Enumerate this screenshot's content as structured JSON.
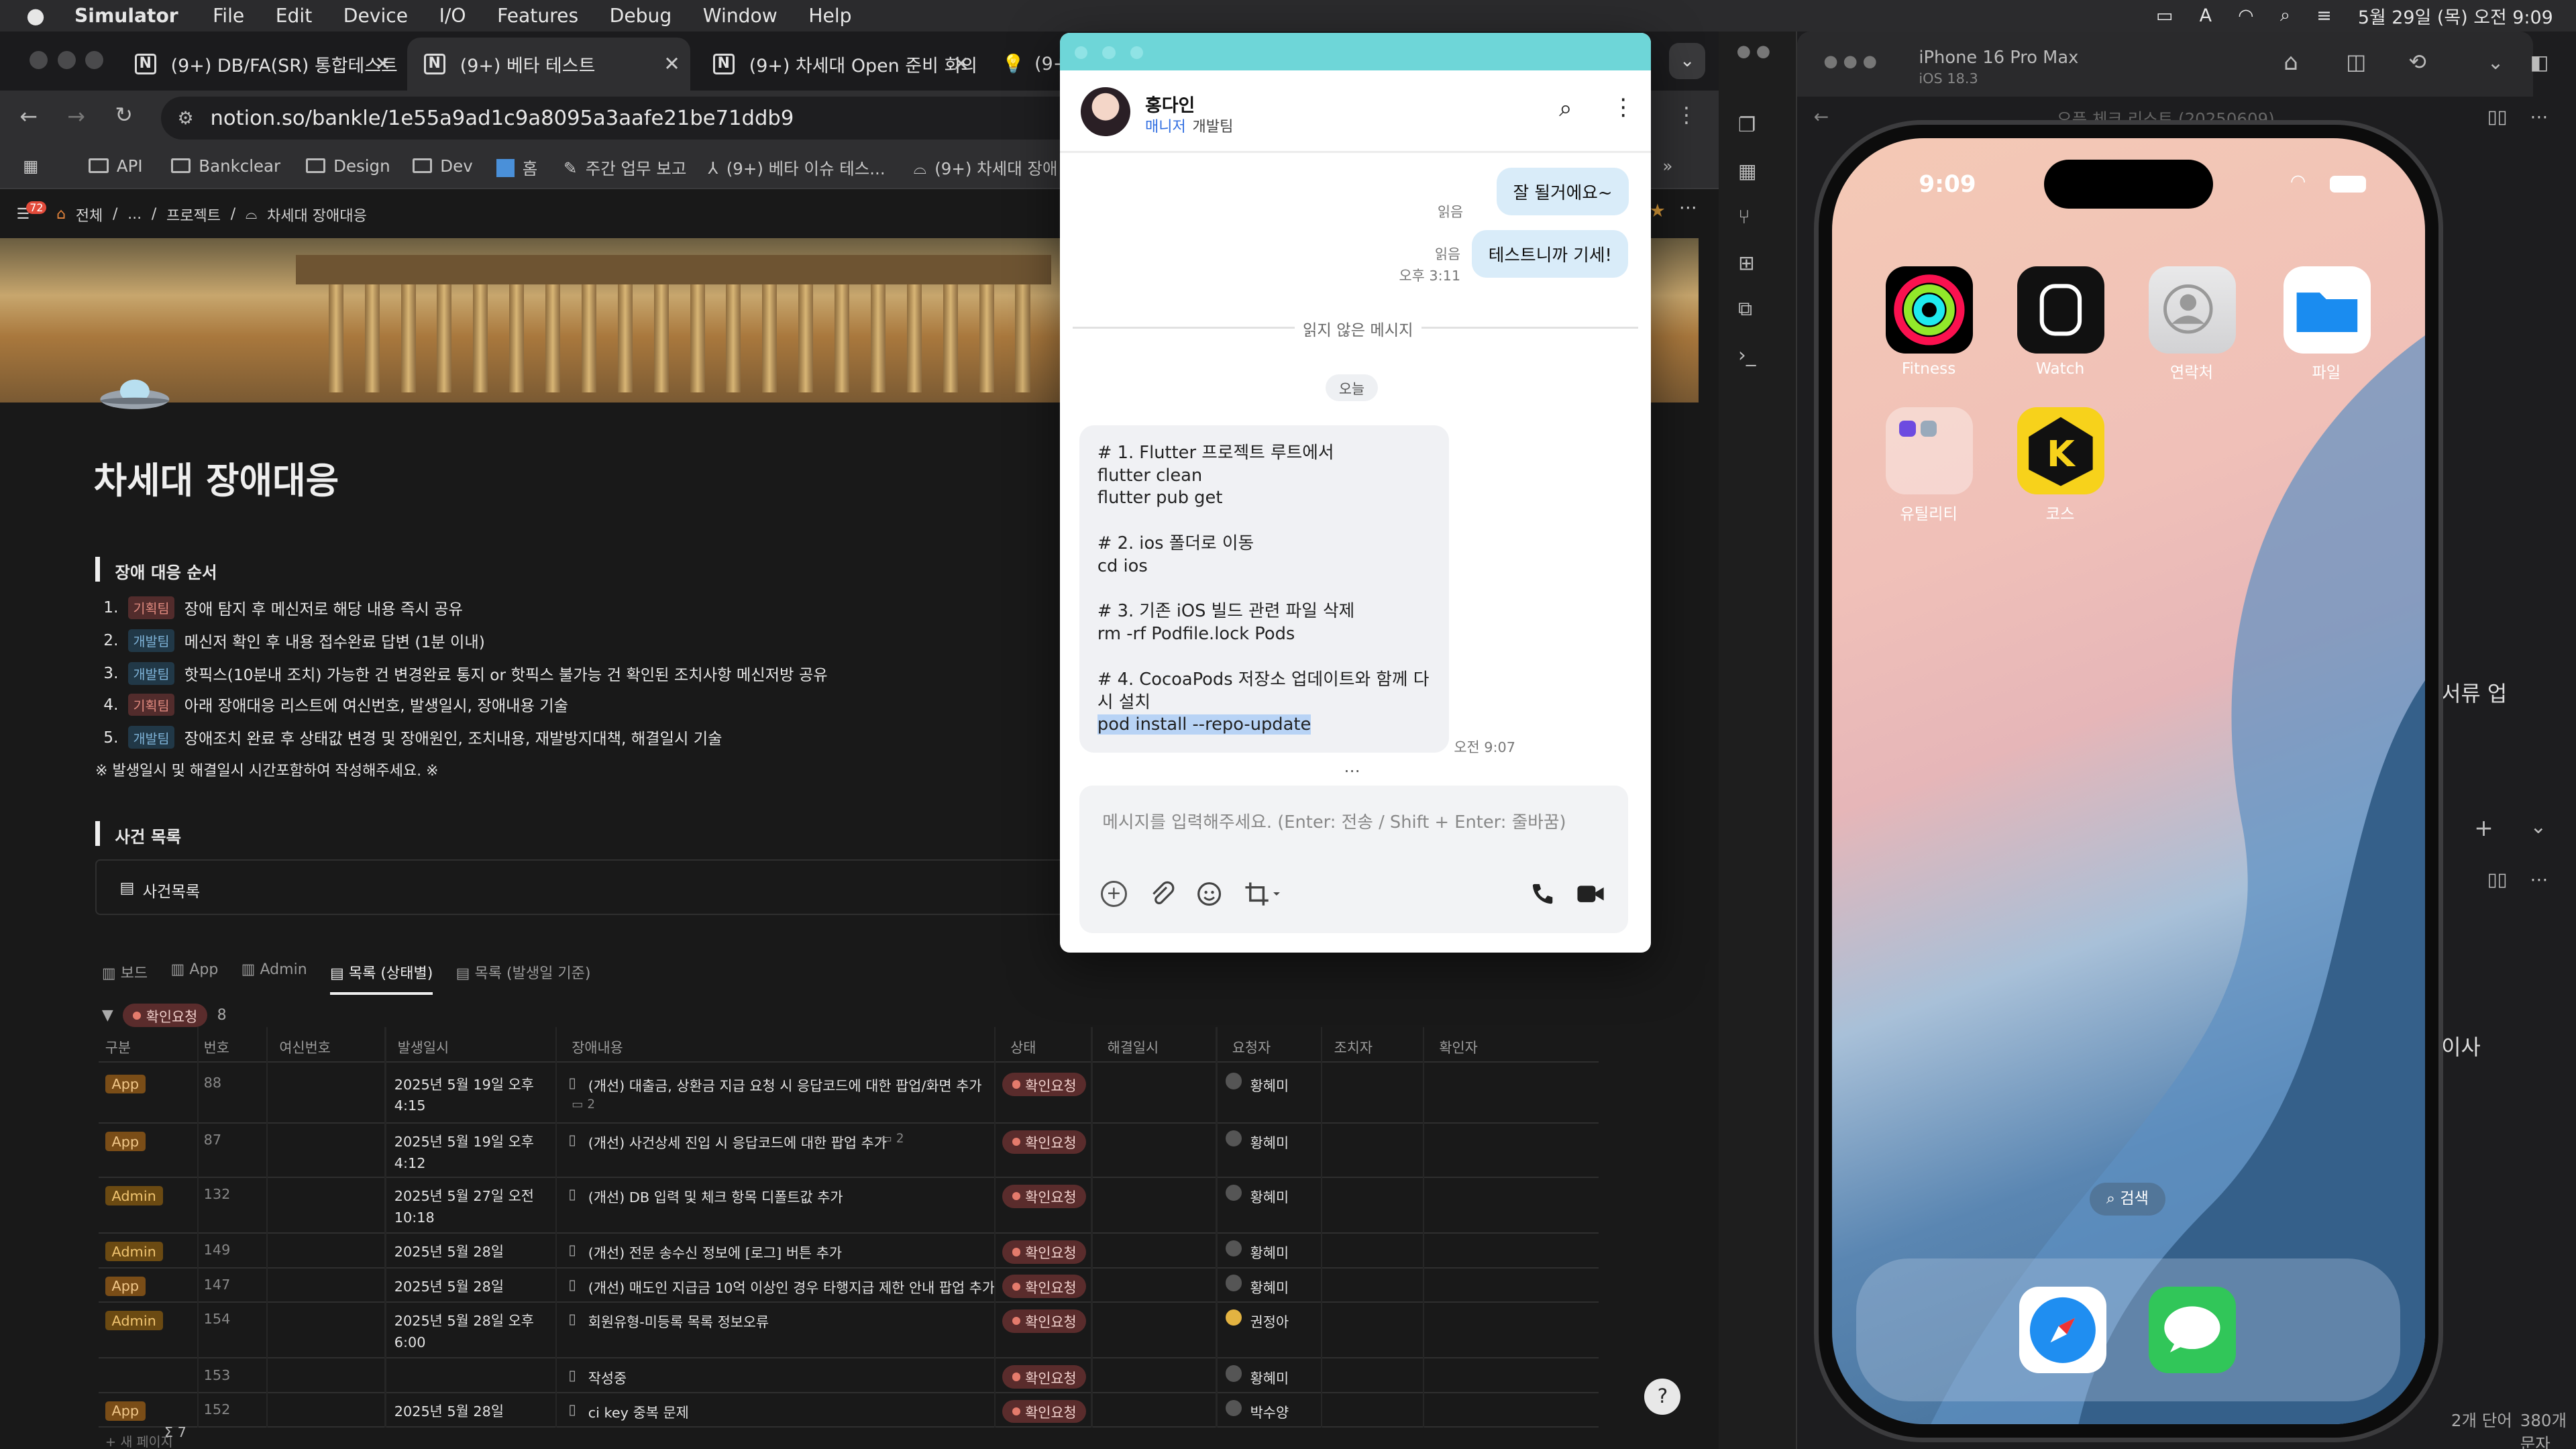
{
  "menubar": {
    "app": "Simulator",
    "items": [
      "File",
      "Edit",
      "Device",
      "I/O",
      "Features",
      "Debug",
      "Window",
      "Help"
    ],
    "datetime": "5월 29일 (목) 오전 9:09"
  },
  "browser": {
    "tabs": [
      {
        "title": "(9+) DB/FA(SR) 통합테스트"
      },
      {
        "title": "(9+) 베타 테스트"
      },
      {
        "title": "(9+) 차세대 Open 준비 회의"
      },
      {
        "title": "(9+"
      }
    ],
    "url": "notion.so/bankle/1e55a9ad1c9a8095a3aafe21be71ddb9",
    "bookmarks": [
      "API",
      "Bankclear",
      "Design",
      "Dev",
      "홈",
      "주간 업무 보고",
      "(9+) 베타 이슈 테스...",
      "(9+) 차세대 장애"
    ]
  },
  "notion": {
    "breadcrumb": [
      "전체",
      "...",
      "프로젝트",
      "차세대 장애대응"
    ],
    "badge": "72",
    "title": "차세대 장애대응",
    "section1": "장애 대응 순서",
    "steps": [
      {
        "num": "1.",
        "team": "기획팀",
        "color": "red",
        "text": "장애 탐지 후 메신저로 해당 내용 즉시 공유"
      },
      {
        "num": "2.",
        "team": "개발팀",
        "color": "blue",
        "text": "메신저 확인 후 내용 접수완료 답변 (1분 이내)"
      },
      {
        "num": "3.",
        "team": "개발팀",
        "color": "blue",
        "text": "핫픽스(10분내 조치) 가능한 건 변경완료 통지 or 핫픽스 불가능 건 확인된 조치사항 메신저방 공유"
      },
      {
        "num": "4.",
        "team": "기획팀",
        "color": "red",
        "text": "아래 장애대응 리스트에 여신번호, 발생일시, 장애내용 기술"
      },
      {
        "num": "5.",
        "team": "개발팀",
        "color": "blue",
        "text": "장애조치 완료 후 상태값 변경 및 장애원인, 조치내용, 재발방지대책, 해결일시 기술"
      }
    ],
    "note": "※ 발생일시 및 해결일시 시간포함하여 작성해주세요. ※",
    "section2": "사건 목록",
    "linked": "사건목록",
    "views": [
      "보드",
      "App",
      "Admin",
      "목록 (상태별)",
      "목록 (발생일 기준)"
    ],
    "group": {
      "label": "확인요청",
      "count": "8"
    },
    "columns": [
      "구분",
      "번호",
      "여신번호",
      "발생일시",
      "장애내용",
      "상태",
      "해결일시",
      "요청자",
      "조치자",
      "확인자"
    ],
    "rows": [
      {
        "type": "App",
        "num": "88",
        "date": "2025년 5월 19일 오후 4:15",
        "desc": "(개선) 대출금, 상환금 지급 요청 시 응답코드에 대한 팝업/화면 추가",
        "comments": "2",
        "status": "확인요청",
        "req": "황혜미"
      },
      {
        "type": "App",
        "num": "87",
        "date": "2025년 5월 19일 오후 4:12",
        "desc": "(개선) 사건상세 진입 시 응답코드에 대한 팝업 추가",
        "comments": "2",
        "status": "확인요청",
        "req": "황혜미"
      },
      {
        "type": "Admin",
        "num": "132",
        "date": "2025년 5월 27일 오전 10:18",
        "desc": "(개선) DB 입력 및 체크 항목 디폴트값 추가",
        "comments": "",
        "status": "확인요청",
        "req": "황혜미"
      },
      {
        "type": "Admin",
        "num": "149",
        "date": "2025년 5월 28일",
        "desc": "(개선) 전문 송수신 정보에 [로그] 버튼 추가",
        "comments": "",
        "status": "확인요청",
        "req": "황혜미"
      },
      {
        "type": "App",
        "num": "147",
        "date": "2025년 5월 28일",
        "desc": "(개선) 매도인 지급금 10억 이상인 경우 타행지급 제한 안내 팝업 추가",
        "comments": "",
        "status": "확인요청",
        "req": "황혜미"
      },
      {
        "type": "Admin",
        "num": "154",
        "date": "2025년 5월 28일 오후 6:00",
        "desc": "회원유형-미등록 목록 정보오류",
        "comments": "",
        "status": "확인요청",
        "req": "권정아"
      },
      {
        "type": "",
        "num": "153",
        "date": "",
        "desc": "작성중",
        "comments": "",
        "status": "확인요청",
        "req": "황혜미"
      },
      {
        "type": "App",
        "num": "152",
        "date": "2025년 5월 28일",
        "desc": "ci key 중복 문제",
        "comments": "",
        "status": "확인요청",
        "req": "박수양"
      }
    ],
    "footer_count": "7"
  },
  "chat": {
    "name": "홍다인",
    "role": "매니저",
    "team": "개발팀",
    "messages_out": [
      {
        "text": "잘 될거에요~",
        "read": "읽음",
        "time": ""
      },
      {
        "text": "테스트니까 기세!",
        "read": "읽음",
        "time": "오후 3:11"
      }
    ],
    "unread_label": "읽지 않은 메시지",
    "today": "오늘",
    "code_lines": [
      "# 1. Flutter 프로젝트 루트에서",
      "flutter clean",
      "flutter pub get",
      "",
      "# 2. ios 폴더로 이동",
      "cd ios",
      "",
      "# 3. 기존 iOS 빌드 관련 파일 삭제",
      "rm -rf Podfile.lock Pods",
      "",
      "# 4. CocoaPods 저장소 업데이트와 함께 다",
      "시 설치"
    ],
    "code_highlight": "pod install --repo-update",
    "code_time": "오전 9:07",
    "placeholder": "메시지를 입력해주세요. (Enter: 전송 / Shift + Enter: 줄바꿈)"
  },
  "simulator": {
    "device": "iPhone 16 Pro Max",
    "os": "iOS 18.3",
    "time": "9:09",
    "apps": [
      {
        "label": "Fitness"
      },
      {
        "label": "Watch"
      },
      {
        "label": "연락처"
      },
      {
        "label": "파일"
      },
      {
        "label": "유틸리티"
      },
      {
        "label": "코스"
      }
    ],
    "search": "검색",
    "behind_texts": [
      "오픈 체크 리스트 (20250609)",
      "서류 업",
      "이사",
      "2개 단어",
      "380개 문자"
    ]
  }
}
